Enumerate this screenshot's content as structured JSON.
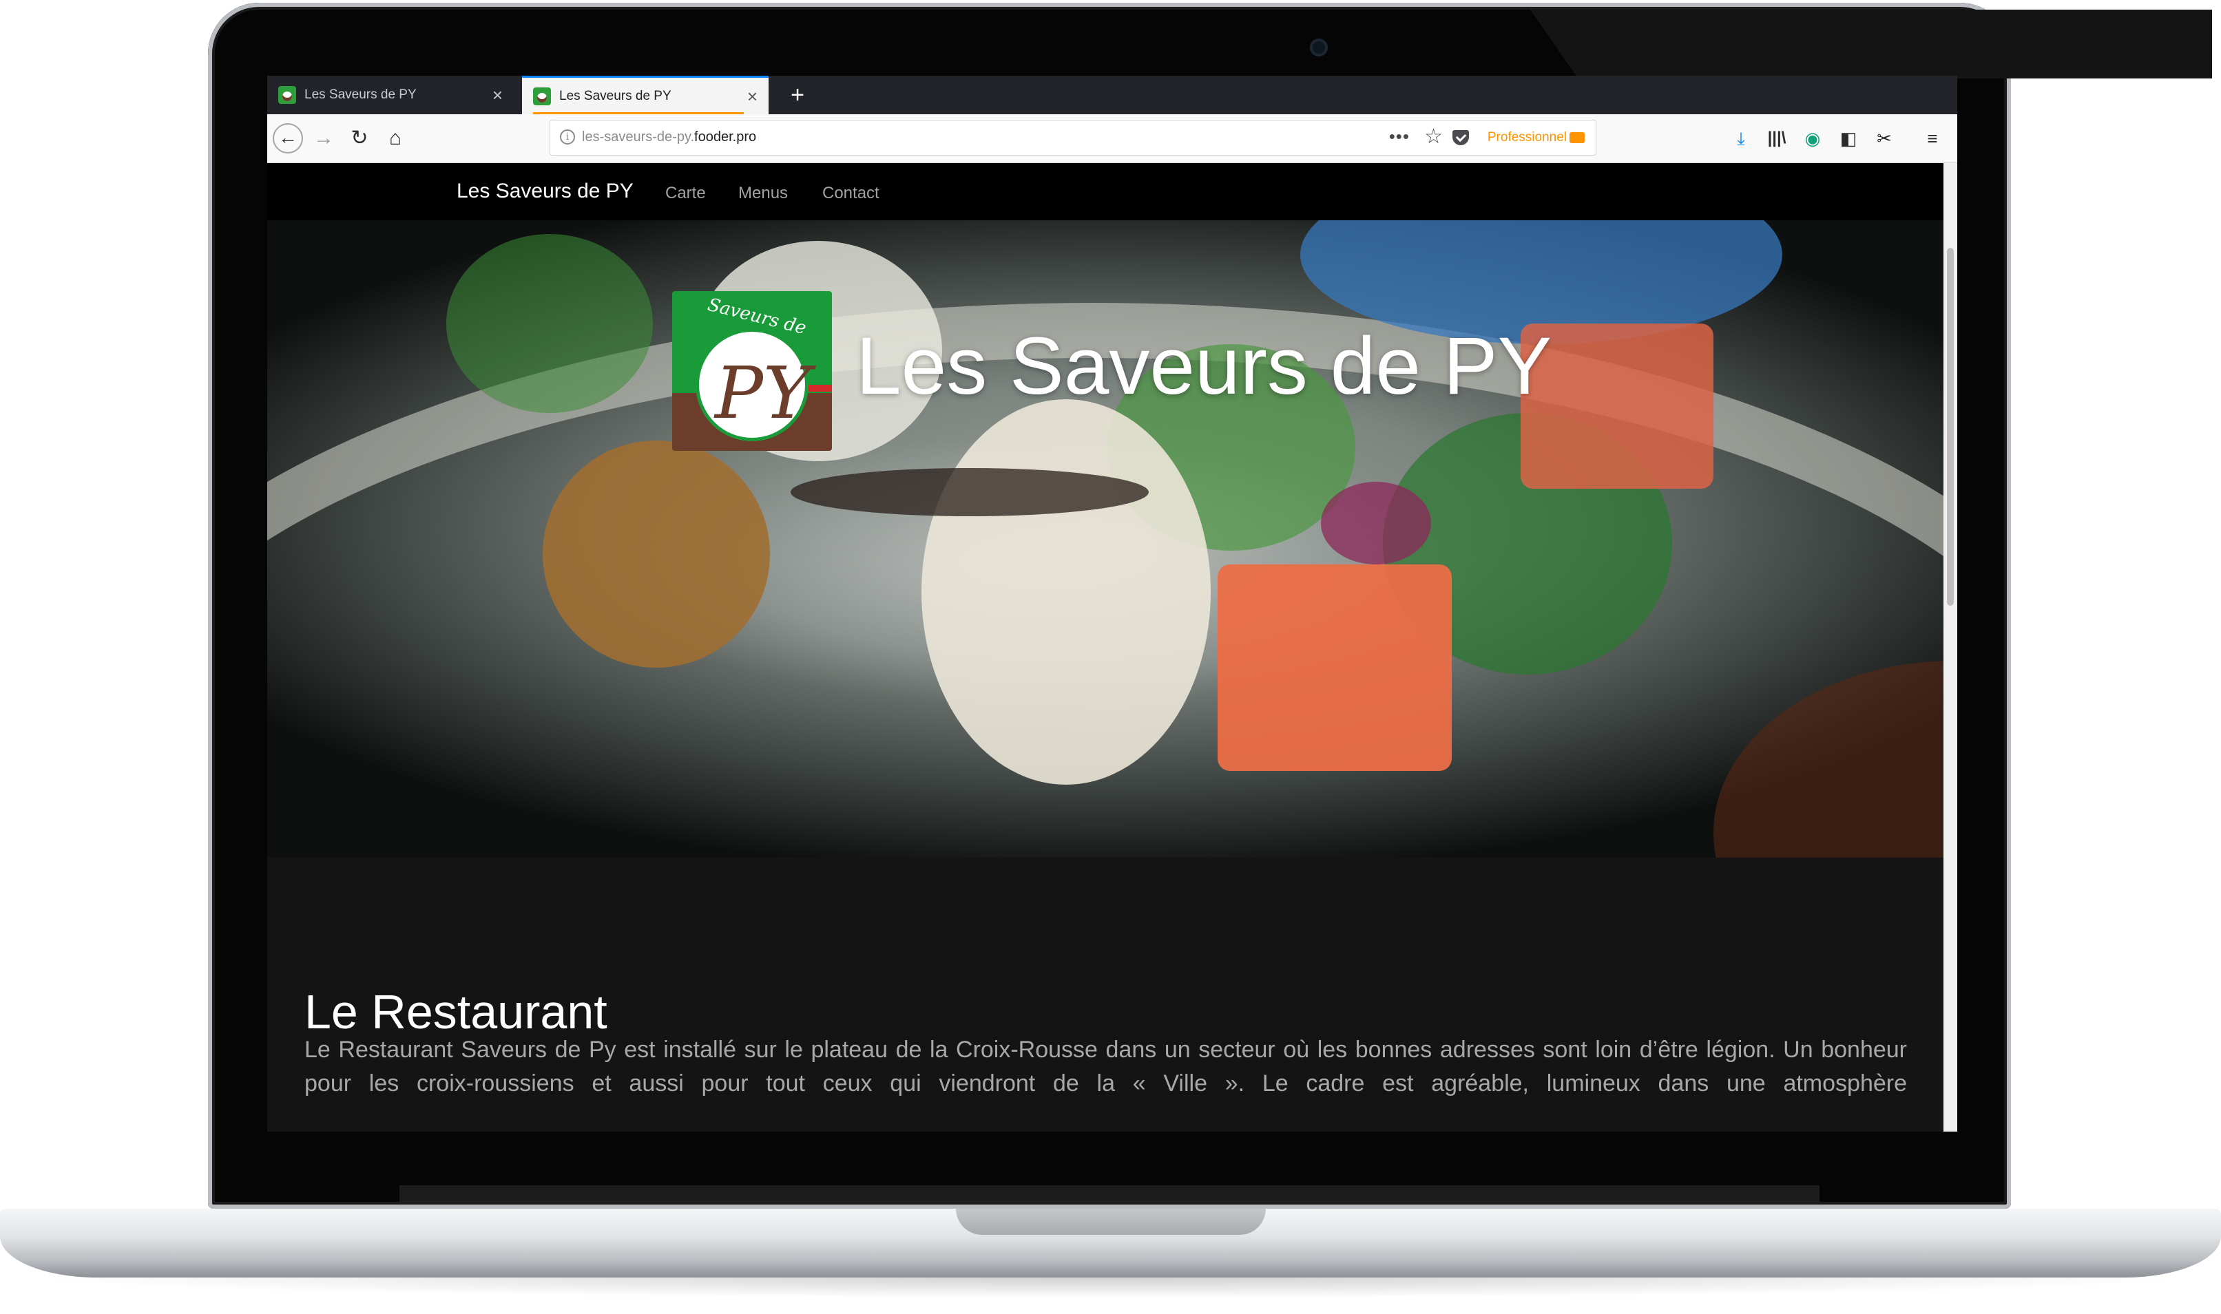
{
  "browser": {
    "tabs": [
      {
        "title": "Les Saveurs de PY",
        "active": false
      },
      {
        "title": "Les Saveurs de PY",
        "active": true
      }
    ],
    "new_tab_label": "+",
    "url": {
      "prefix": "les-saveurs-de-py.",
      "domain": "fooder.pro"
    },
    "container_label": "Professionnel",
    "icons": {
      "back": "back-arrow-icon",
      "forward": "forward-arrow-icon",
      "reload": "reload-icon",
      "home": "home-icon",
      "info": "info-icon",
      "more": "more-icon",
      "bookmark": "star-icon",
      "pocket": "pocket-icon",
      "downloads": "download-icon",
      "library": "library-icon",
      "extension": "extension-icon",
      "sidebar": "sidebar-icon",
      "screenshot": "screenshot-icon",
      "menu": "hamburger-menu-icon"
    }
  },
  "site": {
    "brand": "Les Saveurs de PY",
    "nav": [
      "Carte",
      "Menus",
      "Contact"
    ],
    "hero": {
      "title": "Les Saveurs de PY",
      "logo": {
        "arc_text": "Saveurs de",
        "monogram": "PY"
      }
    },
    "section": {
      "title": "Le Restaurant",
      "text": "Le Restaurant Saveurs de Py est installé sur le plateau de la Croix-Rousse dans un secteur où les bonnes adresses sont loin d’être légion. Un bonheur pour les croix-roussiens et aussi pour tout ceux qui viendront de la « Ville ». Le cadre est agréable, lumineux dans une atmosphère"
    }
  },
  "colors": {
    "accent_orange": "#ff9400",
    "logo_green": "#1a9b3a",
    "logo_brown": "#6d3d2c",
    "page_background": "#141414"
  }
}
